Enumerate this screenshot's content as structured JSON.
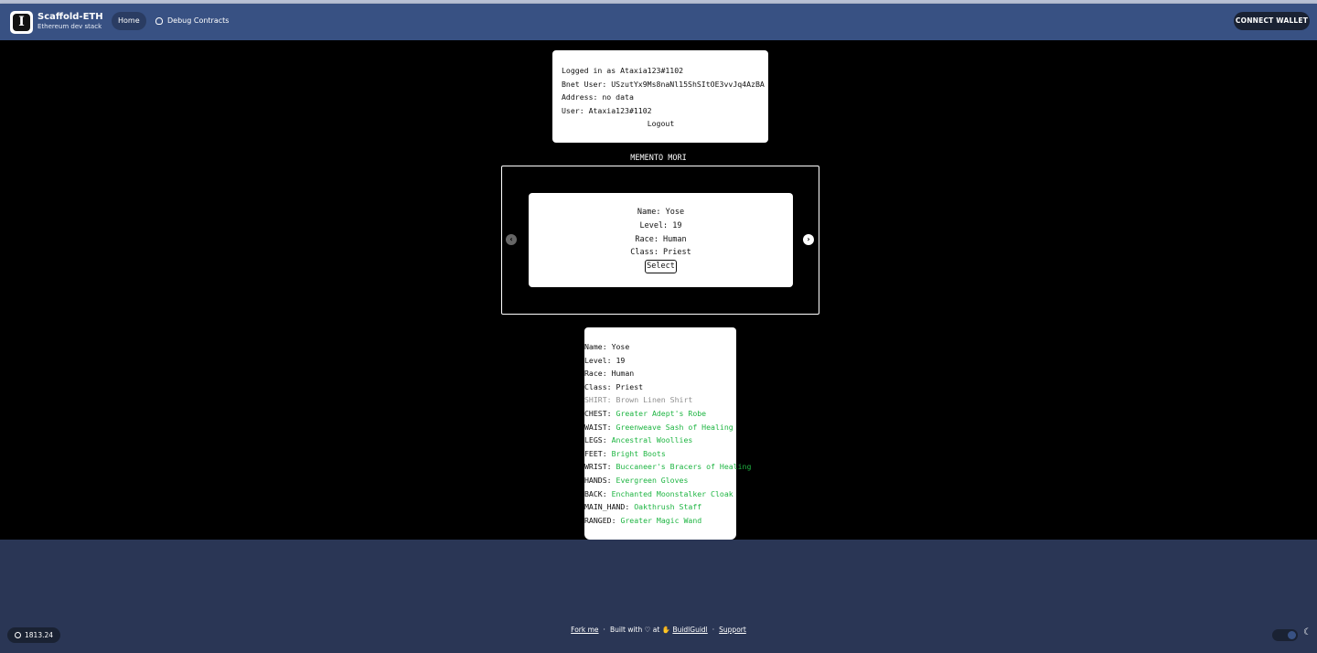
{
  "header": {
    "brand_title": "Scaffold-ETH",
    "brand_subtitle": "Ethereum dev stack",
    "logo_glyph": "I",
    "nav": [
      {
        "label": "Home",
        "icon": null
      },
      {
        "label": "Debug Contracts",
        "icon": "bug-icon"
      }
    ],
    "connect_label": "CONNECT WALLET"
  },
  "login": {
    "logged_in_as": "Logged in as Ataxia123#1102",
    "bnet_user": "Bnet User: USzutYx9Ms8naNl15ShSItOE3vvJq4AzBA",
    "address": "Address: no data",
    "user": "User: Ataxia123#1102",
    "logout_label": "Logout"
  },
  "section_title": "MEMENTO MORI",
  "carousel": {
    "prev_glyph": "‹",
    "next_glyph": "›",
    "card": {
      "name": "Name: Yose",
      "level": "Level: 19",
      "race": "Race: Human",
      "class": "Class: Priest",
      "select_label": "Select"
    }
  },
  "details": {
    "name": "Name: Yose",
    "level": "Level: 19",
    "race": "Race: Human",
    "class": "Class: Priest",
    "gear": [
      {
        "slot": "SHIRT:",
        "item": "Brown Linen Shirt",
        "quality": "common"
      },
      {
        "slot": "CHEST:",
        "item": "Greater Adept's Robe",
        "quality": "uncommon"
      },
      {
        "slot": "WAIST:",
        "item": "Greenweave Sash of Healing",
        "quality": "uncommon"
      },
      {
        "slot": "LEGS:",
        "item": "Ancestral Woollies",
        "quality": "uncommon"
      },
      {
        "slot": "FEET:",
        "item": "Bright Boots",
        "quality": "uncommon"
      },
      {
        "slot": "WRIST:",
        "item": "Buccaneer's Bracers of Healing",
        "quality": "uncommon"
      },
      {
        "slot": "HANDS:",
        "item": "Evergreen Gloves",
        "quality": "uncommon"
      },
      {
        "slot": "BACK:",
        "item": "Enchanted Moonstalker Cloak",
        "quality": "uncommon"
      },
      {
        "slot": "MAIN_HAND:",
        "item": "Oakthrush Staff",
        "quality": "uncommon"
      },
      {
        "slot": "RANGED:",
        "item": "Greater Magic Wand",
        "quality": "uncommon"
      }
    ],
    "colors": {
      "common": "#8f8f8f",
      "uncommon": "#1eb542"
    }
  },
  "footer": {
    "price": "1813.24",
    "fork_label": "Fork me",
    "built_with": "Built with",
    "heart": "♡",
    "at": "at",
    "buidlguidl_label": "BuidlGuidl",
    "support_label": "Support",
    "separator": "·",
    "moon_glyph": "☾"
  }
}
